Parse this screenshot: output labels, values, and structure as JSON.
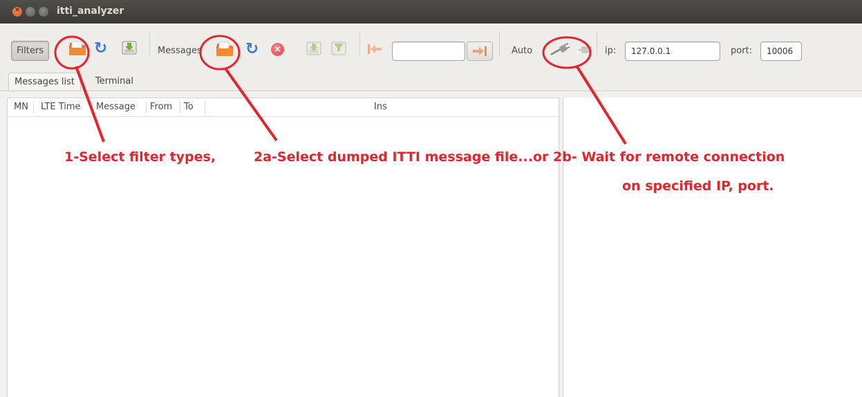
{
  "window": {
    "title": "itti_analyzer"
  },
  "toolbar": {
    "filters_label": "Filters",
    "messages_label": "Messages",
    "auto_label": "Auto",
    "message_number_value": "",
    "ip_label": "ip:",
    "ip_value": "127.0.0.1",
    "port_label": "port:",
    "port_value": "10006"
  },
  "tabs": [
    {
      "label": "Messages list",
      "active": true
    },
    {
      "label": "Terminal",
      "active": false
    }
  ],
  "table": {
    "columns": [
      "MN",
      "LTE Time",
      "Message",
      "From",
      "To",
      "Ins"
    ]
  },
  "annotations": {
    "step1": "1-Select filter types,",
    "step2": "2a-Select dumped ITTI message file...or 2b- Wait for remote connection",
    "step2_line2": "on specified IP, port."
  },
  "colors": {
    "annotation": "#e2262c",
    "titlebar": "#3c3b37",
    "refresh_blue": "#3c7bc6",
    "stop_red": "#dd3f47"
  }
}
